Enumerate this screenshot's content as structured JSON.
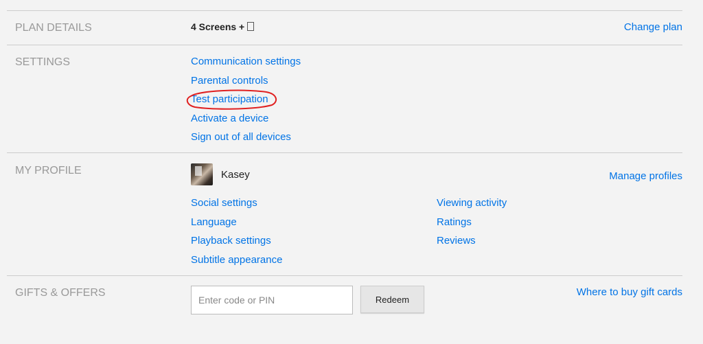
{
  "plan_details": {
    "title": "PLAN DETAILS",
    "plan_name": "4 Screens +",
    "hd_icon": "hd-box-icon",
    "change_plan": "Change plan"
  },
  "settings": {
    "title": "SETTINGS",
    "items": [
      {
        "label": "Communication settings"
      },
      {
        "label": "Parental controls"
      },
      {
        "label": "Test participation"
      },
      {
        "label": "Activate a device"
      },
      {
        "label": "Sign out of all devices"
      }
    ]
  },
  "annotation": {
    "color": "#e02020",
    "shape": "red hand-drawn ellipse around Test participation"
  },
  "my_profile": {
    "title": "MY PROFILE",
    "profile_name": "Kasey",
    "manage_profiles": "Manage profiles",
    "left_links": [
      {
        "label": "Social settings"
      },
      {
        "label": "Language"
      },
      {
        "label": "Playback settings"
      },
      {
        "label": "Subtitle appearance"
      }
    ],
    "right_links": [
      {
        "label": "Viewing activity"
      },
      {
        "label": "Ratings"
      },
      {
        "label": "Reviews"
      }
    ]
  },
  "gifts": {
    "title": "GIFTS & OFFERS",
    "code_placeholder": "Enter code or PIN",
    "redeem": "Redeem",
    "where_to_buy": "Where to buy gift cards"
  },
  "colors": {
    "link": "#0073e6",
    "section_title": "#999999",
    "divider": "#cccccc",
    "background": "#f3f3f3"
  }
}
